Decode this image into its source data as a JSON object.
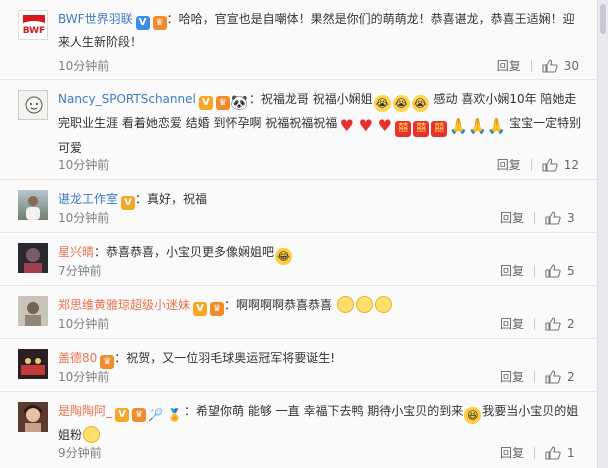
{
  "comments": [
    {
      "user": "BWF世界羽联",
      "text_1": "：哈哈，官宣也是自嘲体！果然是你们的萌萌龙！恭喜谌龙，恭喜王适娴！迎来人生新阶段！",
      "time": "10分钟前",
      "reply": "回复",
      "likes": "30"
    },
    {
      "user": "Nancy_SPORTSchannel",
      "text_1": "：祝福龙哥 祝福小娴姐",
      "text_2": "感动 喜欢小娴10年 陪她走完职业生涯 看着她恋爱 结婚 到怀孕啊 祝福祝福祝福",
      "text_3": "宝宝一定特别可爱",
      "time": "10分钟前",
      "reply": "回复",
      "likes": "12"
    },
    {
      "user": "谌龙工作室",
      "text_1": "：真好，祝福",
      "time": "10分钟前",
      "reply": "回复",
      "likes": "3"
    },
    {
      "user": "星兴晴",
      "text_1": "：恭喜恭喜，小宝贝更多像娴姐吧",
      "time": "7分钟前",
      "reply": "回复",
      "likes": "5"
    },
    {
      "user": "郑思维黄雅琼超级小迷妹",
      "text_1": "：啊啊啊啊恭喜恭喜",
      "time": "10分钟前",
      "reply": "回复",
      "likes": "2"
    },
    {
      "user": "盖德80",
      "text_1": "：祝贺，又一位羽毛球奥运冠军将要诞生!",
      "time": "10分钟前",
      "reply": "回复",
      "likes": "2"
    },
    {
      "user": "是陶陶阿_",
      "text_1": "：希望你萌 能够 一直 幸福下去鸭 期待小宝贝的到来",
      "text_2": "我要当小宝贝的姐姐粉",
      "time": "9分钟前",
      "reply": "回复",
      "likes": "1"
    }
  ],
  "avatar_bwf_text": "BWF",
  "colors": {
    "username_orange": "#eb7350",
    "username_blue": "#3a7cc6",
    "meta_gray": "#808080"
  },
  "icons": {
    "like": "thumbs-up-icon",
    "verified": "verified-v-icon",
    "member": "member-crown-icon"
  }
}
